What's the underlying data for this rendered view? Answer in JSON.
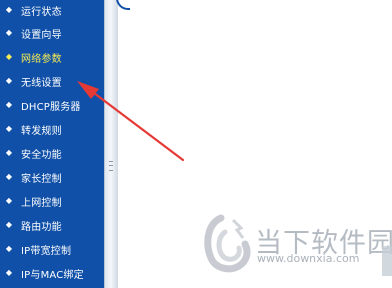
{
  "sidebar": {
    "items": [
      {
        "label": "运行状态",
        "active": false
      },
      {
        "label": "设置向导",
        "active": false
      },
      {
        "label": "网络参数",
        "active": true
      },
      {
        "label": "无线设置",
        "active": false
      },
      {
        "label": "DHCP服务器",
        "active": false
      },
      {
        "label": "转发规则",
        "active": false
      },
      {
        "label": "安全功能",
        "active": false
      },
      {
        "label": "家长控制",
        "active": false
      },
      {
        "label": "上网控制",
        "active": false
      },
      {
        "label": "路由功能",
        "active": false
      },
      {
        "label": "IP带宽控制",
        "active": false
      },
      {
        "label": "IP与MAC绑定",
        "active": false
      }
    ],
    "bullet_icon": "diamond-bullet"
  },
  "watermark": {
    "brand": "当下软件园",
    "url": "www.downxia.com"
  },
  "colors": {
    "sidebar_bg": "#1050a8",
    "menu_text": "#ffffff",
    "active_text": "#f3ea55",
    "arrow": "#e53935"
  }
}
